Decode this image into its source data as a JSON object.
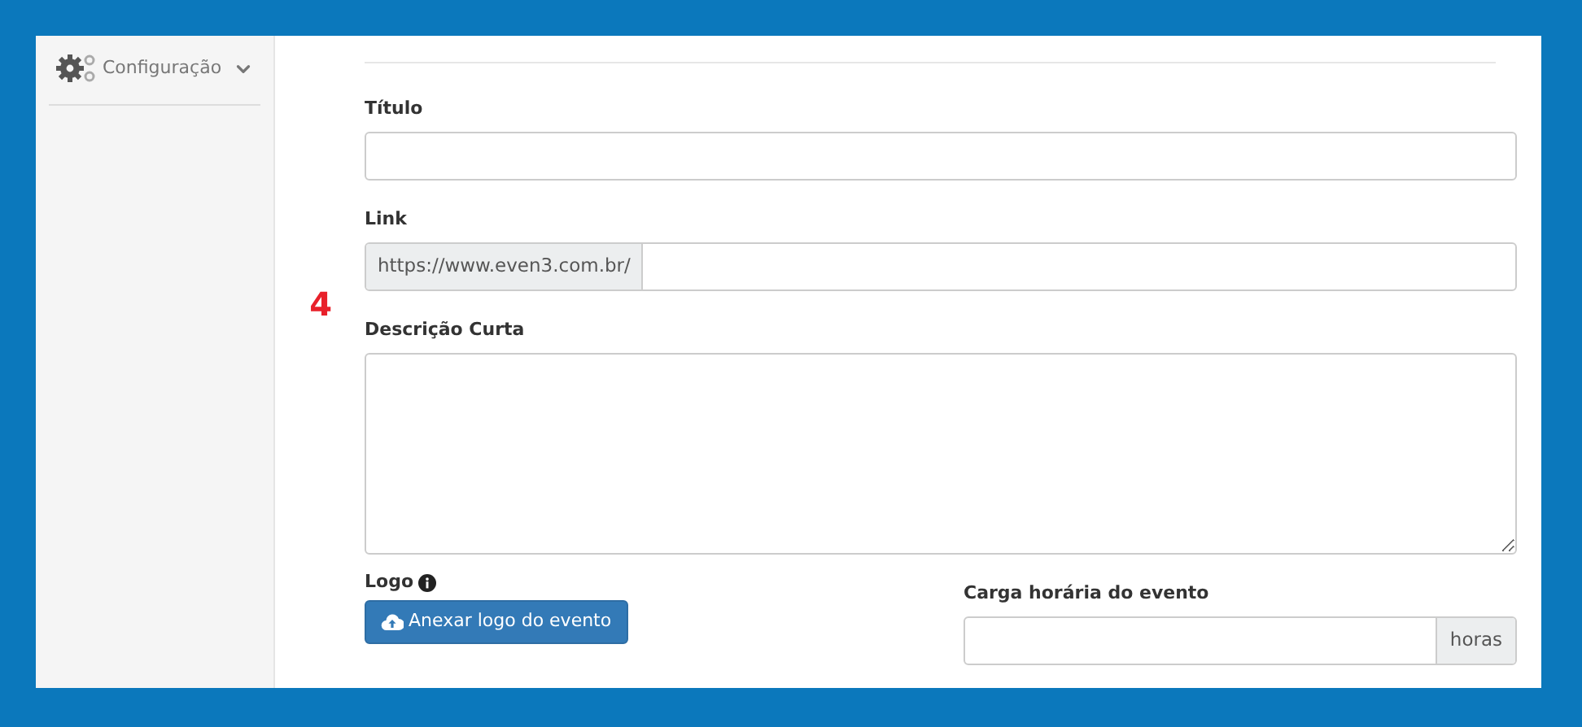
{
  "sidebar": {
    "items": [
      {
        "label": "Configuração",
        "expanded": false
      }
    ]
  },
  "annotation": "4",
  "form": {
    "title_field": {
      "label": "Título"
    },
    "link_field": {
      "label": "Link",
      "prefix": "https://www.even3.com.br/"
    },
    "description_field": {
      "label": "Descrição Curta"
    },
    "logo": {
      "label": "Logo",
      "button": "Anexar logo do evento"
    },
    "hours_field": {
      "label": "Carga horária do evento",
      "suffix": "horas"
    }
  }
}
